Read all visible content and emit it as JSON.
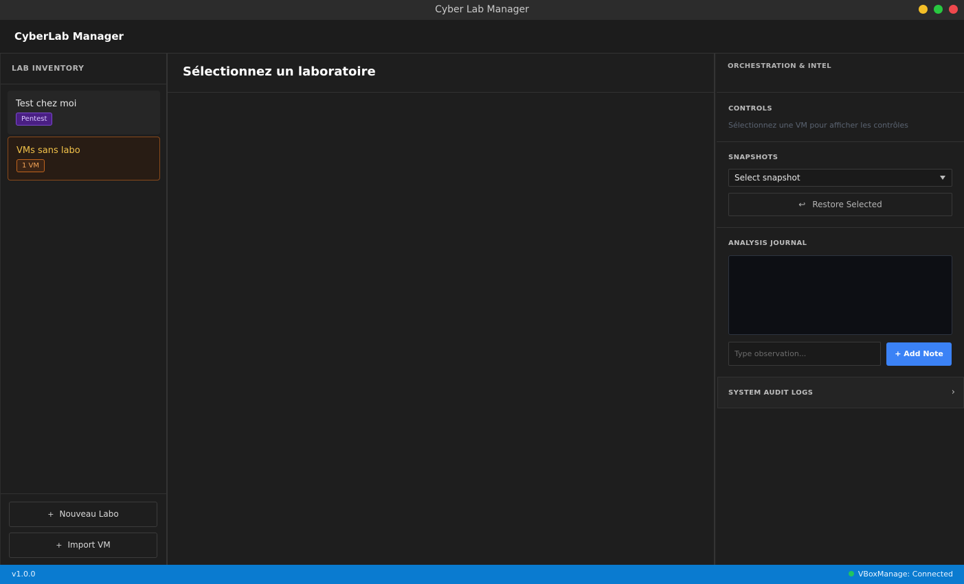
{
  "window": {
    "title": "Cyber Lab Manager"
  },
  "header": {
    "brand": "CyberLab Manager"
  },
  "sidebar": {
    "heading": "LAB INVENTORY",
    "labs": [
      {
        "name": "Test chez moi",
        "badge": "Pentest"
      },
      {
        "name": "VMs sans labo",
        "badge": "1 VM"
      }
    ],
    "buttons": {
      "new_lab": "Nouveau Labo",
      "import_vm": "Import VM"
    }
  },
  "main": {
    "title": "Sélectionnez un laboratoire"
  },
  "panel": {
    "heading": "ORCHESTRATION & INTEL",
    "controls": {
      "label": "CONTROLS",
      "hint": "Sélectionnez une VM pour afficher les contrôles"
    },
    "snapshots": {
      "label": "SNAPSHOTS",
      "selected": "Select snapshot",
      "restore_label": "Restore Selected"
    },
    "journal": {
      "label": "ANALYSIS JOURNAL",
      "placeholder": "Type observation...",
      "add_label": "+ Add Note"
    },
    "audit": {
      "label": "SYSTEM AUDIT LOGS"
    }
  },
  "status": {
    "version": "v1.0.0",
    "connection": "VBoxManage: Connected",
    "connection_color": "#22c55e"
  },
  "colors": {
    "accent": "#3b82f6",
    "statusbar": "#0a7bd0"
  }
}
